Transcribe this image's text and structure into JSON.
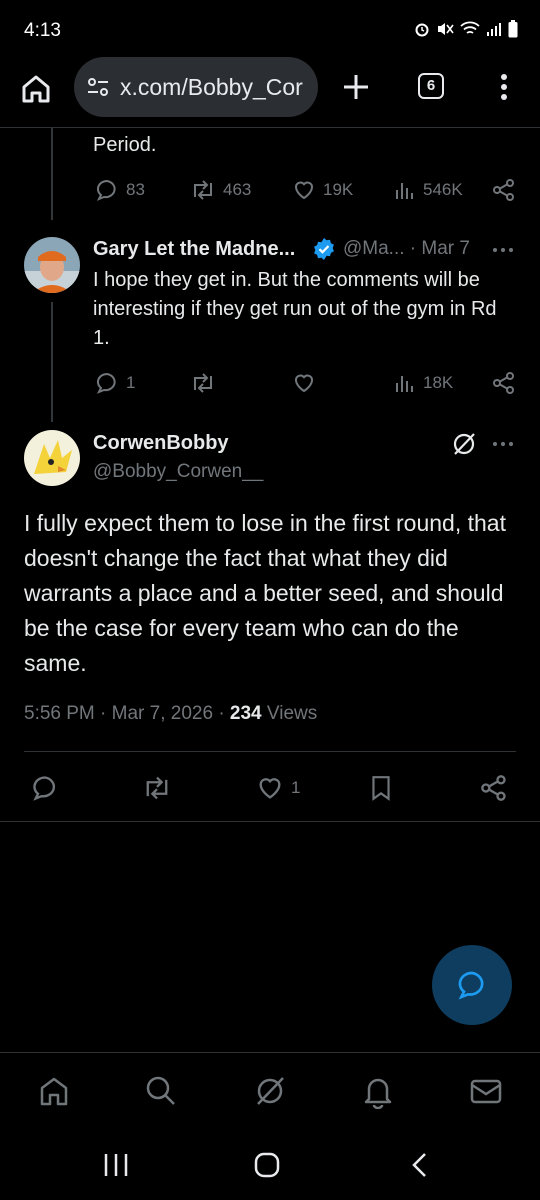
{
  "status": {
    "time": "4:13"
  },
  "browser": {
    "url": "x.com/Bobby_Cor",
    "tab_count": "6"
  },
  "prev_tweet": {
    "text_tail": "Period.",
    "replies": "83",
    "retweets": "463",
    "likes": "19K",
    "views": "546K"
  },
  "reply_tweet": {
    "name": "Gary Let the Madne...",
    "handle_date": "@Ma... · Mar 7",
    "text": "I hope they get in. But the comments will be interesting if they get run out of the gym in Rd 1.",
    "replies": "1",
    "views": "18K"
  },
  "main_tweet": {
    "name": "CorwenBobby",
    "handle": "@Bobby_Corwen__",
    "text": "I fully expect them to lose in the first round, that doesn't change the fact that what they did warrants a place and a better seed, and should be the case for every team who can do the same.",
    "timestamp": "5:56 PM · Mar 7, 2026 · ",
    "views_count": "234",
    "views_label": " Views",
    "likes": "1"
  },
  "colors": {
    "accent": "#1d9bf0",
    "muted": "#71767b",
    "background": "#000000"
  }
}
